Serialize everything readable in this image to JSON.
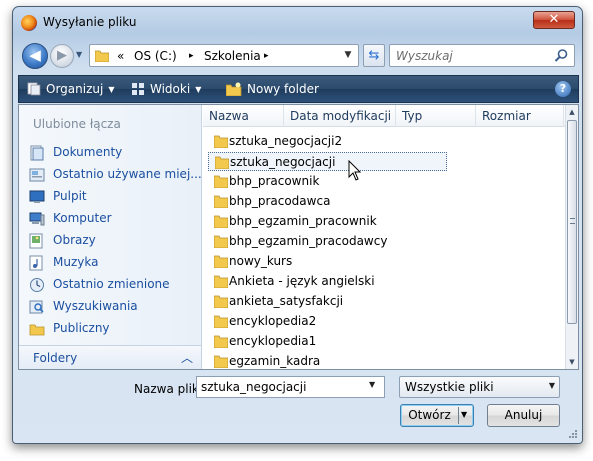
{
  "window": {
    "title": "Wysyłanie pliku",
    "close_label": "✕"
  },
  "navigation": {
    "back_label": "◀",
    "forward_label": "▶",
    "address": {
      "chevron": "«",
      "segments": [
        "OS (C:)",
        "Szkolenia"
      ],
      "separator": "▸"
    },
    "search": {
      "placeholder": "Wyszukaj"
    }
  },
  "toolbar": {
    "organize_label": "Organizuj",
    "views_label": "Widoki",
    "new_folder_label": "Nowy folder",
    "help_label": "?"
  },
  "sidebar": {
    "header": "Ulubione łącza",
    "items": [
      {
        "label": "Dokumenty",
        "icon": "documents-icon"
      },
      {
        "label": "Ostatnio używane miej...",
        "icon": "recent-places-icon"
      },
      {
        "label": "Pulpit",
        "icon": "desktop-icon"
      },
      {
        "label": "Komputer",
        "icon": "computer-icon"
      },
      {
        "label": "Obrazy",
        "icon": "pictures-icon"
      },
      {
        "label": "Muzyka",
        "icon": "music-icon"
      },
      {
        "label": "Ostatnio zmienione",
        "icon": "recently-changed-icon"
      },
      {
        "label": "Wyszukiwania",
        "icon": "searches-icon"
      },
      {
        "label": "Publiczny",
        "icon": "public-folder-icon"
      }
    ],
    "folders_label": "Foldery",
    "folders_chevron": "︿"
  },
  "columns": [
    "Nazwa",
    "Data modyfikacji",
    "Typ",
    "Rozmiar"
  ],
  "files": [
    {
      "name": "sztuka_negocjacji2",
      "selected": false
    },
    {
      "name": "sztuka_negocjacji",
      "selected": true
    },
    {
      "name": "bhp_pracownik",
      "selected": false
    },
    {
      "name": "bhp_pracodawca",
      "selected": false
    },
    {
      "name": "bhp_egzamin_pracownik",
      "selected": false
    },
    {
      "name": "bhp_egzamin_pracodawcy",
      "selected": false
    },
    {
      "name": "nowy_kurs",
      "selected": false
    },
    {
      "name": "Ankieta - język angielski",
      "selected": false
    },
    {
      "name": "ankieta_satysfakcji",
      "selected": false
    },
    {
      "name": "encyklopedia2",
      "selected": false
    },
    {
      "name": "encyklopedia1",
      "selected": false
    },
    {
      "name": "egzamin_kadra",
      "selected": false
    }
  ],
  "footer": {
    "filename_label": "Nazwa pliku:",
    "filename_value": "sztuka_negocjacji",
    "filter_value": "Wszystkie pliki",
    "open_label": "Otwórz",
    "cancel_label": "Anuluj"
  },
  "colors": {
    "accent": "#1b4fa0",
    "toolbar": "#2b4a6c",
    "folder": "#f2c94c",
    "close_button": "#c8402a"
  }
}
